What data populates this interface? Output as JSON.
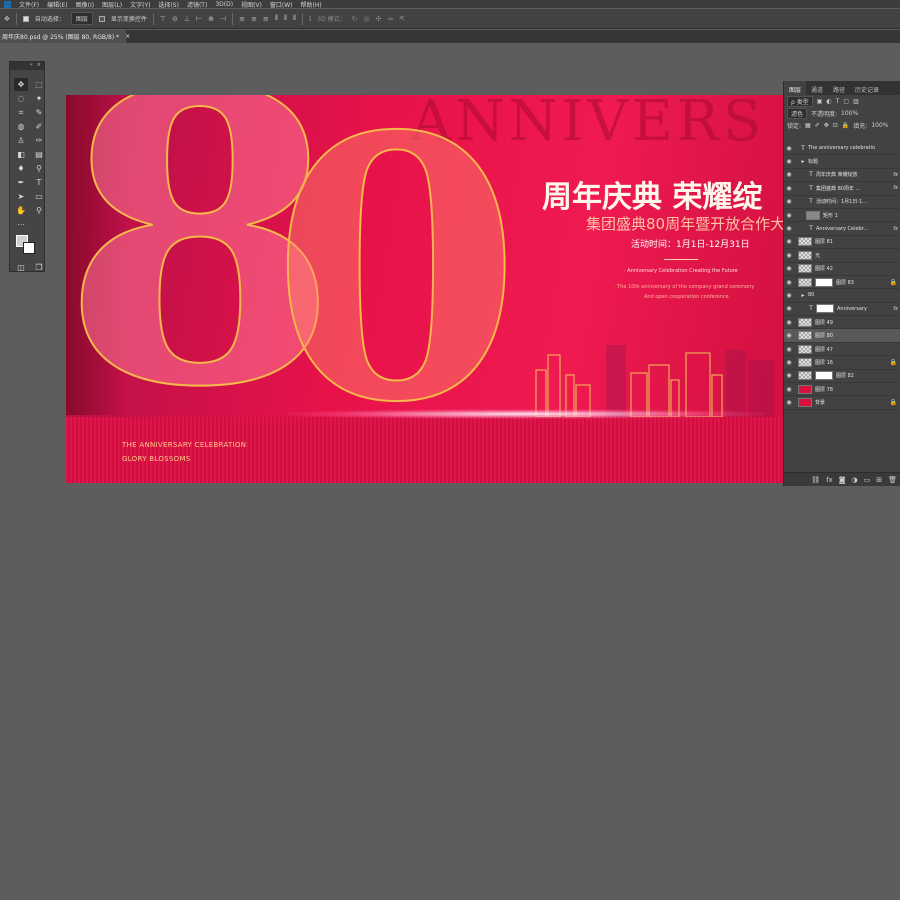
{
  "menu": [
    "文件(F)",
    "编辑(E)",
    "图像(I)",
    "图层(L)",
    "文字(Y)",
    "选择(S)",
    "滤镜(T)",
    "3D(D)",
    "视图(V)",
    "窗口(W)",
    "帮助(H)"
  ],
  "options": {
    "auto_select_label": "自动选择：",
    "auto_select_value": "图层",
    "show_transform_label": "显示变换控件",
    "mode_3d_label": "3D 模式："
  },
  "document_tab": {
    "label": "周年庆80.psd @ 25% (图层 80, RGB/8) *",
    "close": "×"
  },
  "canvas": {
    "big_eight": "8",
    "big_zero": "0",
    "anniversary_watermark": "ANNIVERS",
    "title": "周年庆典 荣耀绽",
    "subtitle": "集团盛典80周年暨开放合作大会",
    "date": "活动时间：1月1日-12月31日",
    "en_line1": "· Anniversary Celebration Creating the Future",
    "en_line2": "· The 10th anniversary of the company grand ceremony",
    "en_line3": "And open cooperation conference",
    "bottom_left_1": "THE ANNIVERSARY CELEBRATION",
    "bottom_left_2": "GLORY BLOSSOMS"
  },
  "layers_panel": {
    "tabs": [
      "图层",
      "通道",
      "路径",
      "历史记录"
    ],
    "filter_kind": "ρ 类型",
    "blend_mode": "滤色",
    "opacity_label": "不透明度:",
    "opacity_value": "100%",
    "lock_label": "锁定:",
    "fill_label": "填充:",
    "fill_value": "100%",
    "layers": [
      {
        "name": "The anniversary celebratio",
        "kind": "T",
        "fx": "",
        "lock": false
      },
      {
        "name": "标题",
        "kind": "folder",
        "fx": "",
        "lock": false
      },
      {
        "name": "周年庆典 荣耀绽放",
        "kind": "T",
        "fx": "fx",
        "lock": false
      },
      {
        "name": "集团盛典 80周年 ...",
        "kind": "T",
        "fx": "fx",
        "lock": false
      },
      {
        "name": "活动时间：1月1日-1...",
        "kind": "T",
        "fx": "",
        "lock": false
      },
      {
        "name": "矩形 1",
        "kind": "shape",
        "fx": "",
        "lock": false
      },
      {
        "name": "Anniversary Celebr...",
        "kind": "T",
        "fx": "fx",
        "lock": false
      },
      {
        "name": "图层 81",
        "kind": "thumb",
        "fx": "",
        "lock": false
      },
      {
        "name": "光",
        "kind": "thumb",
        "fx": "",
        "lock": false
      },
      {
        "name": "图层 42",
        "kind": "thumb",
        "fx": "",
        "lock": false
      },
      {
        "name": "图层 83",
        "kind": "mask",
        "fx": "",
        "lock": true
      },
      {
        "name": "80",
        "kind": "folder",
        "fx": "",
        "lock": false
      },
      {
        "name": "Anniversary",
        "kind": "Tmask",
        "fx": "fx",
        "lock": false
      },
      {
        "name": "图层 49",
        "kind": "thumb",
        "fx": "",
        "lock": false
      },
      {
        "name": "图层 80",
        "kind": "thumb",
        "fx": "",
        "lock": false
      },
      {
        "name": "图层 47",
        "kind": "thumb",
        "fx": "",
        "lock": false
      },
      {
        "name": "图层 16",
        "kind": "thumb",
        "fx": "",
        "lock": true
      },
      {
        "name": "图层 82",
        "kind": "mask",
        "fx": "",
        "lock": false
      },
      {
        "name": "图层 78",
        "kind": "red",
        "fx": "",
        "lock": false
      },
      {
        "name": "背景",
        "kind": "red",
        "fx": "",
        "lock": true
      }
    ],
    "selected_layer": "图层 80",
    "footer_icons": [
      "link-icon",
      "fx-icon",
      "mask-icon",
      "adjustment-icon",
      "folder-icon",
      "new-layer-icon",
      "trash-icon"
    ]
  },
  "colors": {
    "canvas_red": "#e8124a",
    "gold_stroke": "#f6b84a",
    "panel_bg": "#424242",
    "workspace_bg": "#5d5d5d"
  }
}
